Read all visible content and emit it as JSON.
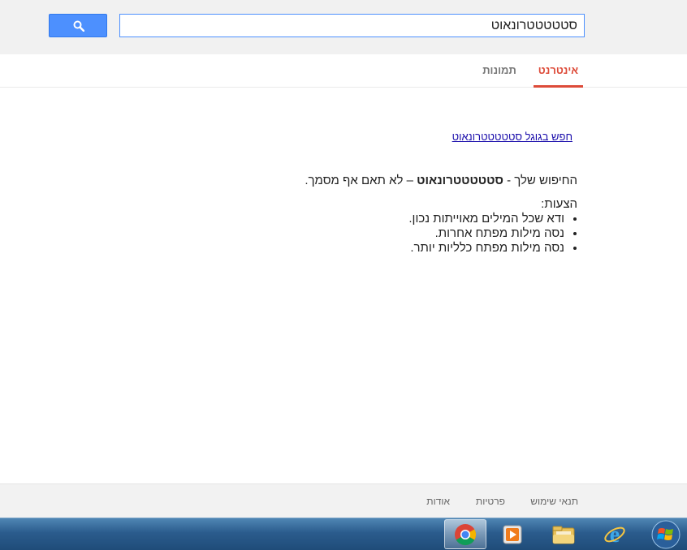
{
  "search": {
    "query": "סטטטטטרונאוט",
    "button_icon": "search-icon"
  },
  "tabs": [
    {
      "label": "אינטרנט",
      "active": true
    },
    {
      "label": "תמונות",
      "active": false
    }
  ],
  "main": {
    "google_link": "חפש בגוגל סטטטטטרונאוט",
    "no_results_prefix": "החיפוש שלך - ",
    "no_results_query": "סטטטטטרונאוט",
    "no_results_suffix": " – לא תאם אף מסמך.",
    "suggestions_title": "הצעות:",
    "suggestions": [
      "ודא שכל המילים מאוייתות נכון.",
      "נסה מילות מפתח אחרות.",
      "נסה מילות מפתח כלליות יותר."
    ]
  },
  "footer": {
    "terms": "תנאי שימוש",
    "privacy": "פרטיות",
    "about": "אודות"
  },
  "taskbar": {
    "items": [
      "chrome-icon",
      "media-player-icon",
      "file-explorer-icon",
      "internet-explorer-icon",
      "windows-start-icon"
    ]
  },
  "colors": {
    "accent_blue": "#4d90fe",
    "active_tab_red": "#dd4b39",
    "link_blue": "#1a0dab"
  }
}
